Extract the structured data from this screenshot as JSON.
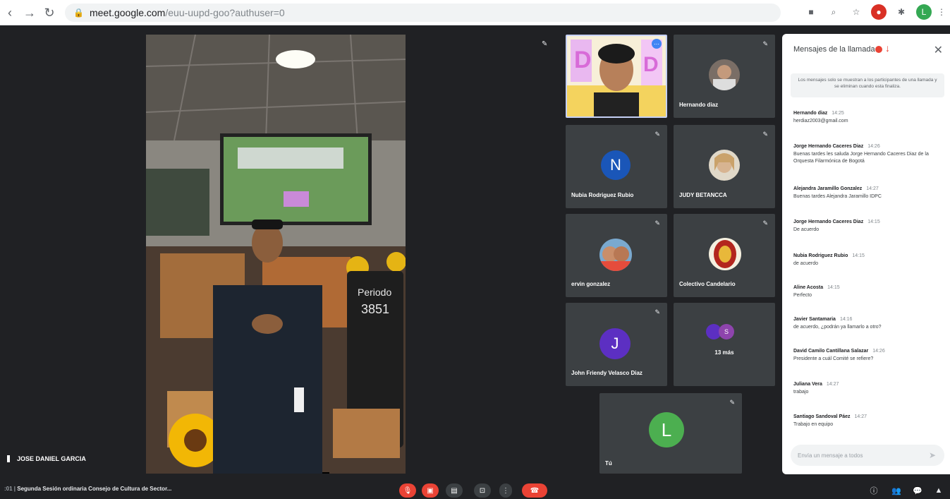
{
  "browser": {
    "url_host": "meet.google.com",
    "url_path": "/euu-uupd-goo?authuser=0"
  },
  "main_video": {
    "speaker_name": "JOSE DANIEL GARCIA",
    "chalkboard": "Periodo 3851"
  },
  "tiles": [
    {
      "name": "",
      "type": "video"
    },
    {
      "name": "Hernando diaz",
      "type": "photo"
    },
    {
      "name": "Nubia Rodriguez Rubio",
      "type": "initial",
      "initial": "N",
      "color": "#1a56b8"
    },
    {
      "name": "JUDY BETANCCA",
      "type": "photo"
    },
    {
      "name": "ervin gonzalez",
      "type": "photo"
    },
    {
      "name": "Colectivo Candelario",
      "type": "photo"
    },
    {
      "name": "John Friendy Velasco Diaz",
      "type": "initial",
      "initial": "J",
      "color": "#5c2fc2"
    },
    {
      "name": "13 más",
      "type": "more"
    },
    {
      "name": "Tú",
      "type": "initial",
      "initial": "L",
      "color": "#4caf50"
    }
  ],
  "chat": {
    "title": "Mensajes de la llamada",
    "notice": "Los mensajes solo se muestran a los participantes de una llamada y se eliminan cuando esta finaliza.",
    "messages": [
      {
        "sender": "Hernando diaz",
        "time": "14:25",
        "text": "herdiaz2003@gmail.com"
      },
      {
        "sender": "Jorge Hernando Caceres Diaz",
        "time": "14:26",
        "text": "Buenas tardes les saluda Jorge Hernando Caceres Diaz de la Orquesta Filarmónica de Bogotá"
      },
      {
        "sender": "Alejandra Jaramillo Gonzalez",
        "time": "14:27",
        "text": "Buenas tardes Alejandra Jaramillo IDPC"
      },
      {
        "sender": "Jorge Hernando Caceres Diaz",
        "time": "14:15",
        "text": "De acuerdo"
      },
      {
        "sender": "Nubia Rodriguez Rubio",
        "time": "14:15",
        "text": "de acuerdo"
      },
      {
        "sender": "Aline Acosta",
        "time": "14:15",
        "text": "Perfecto"
      },
      {
        "sender": "Javier Santamaria",
        "time": "14:16",
        "text": "de acuerdo, ¿podrán ya llamarlo a otro?"
      },
      {
        "sender": "David Camilo Cantillana Salazar",
        "time": "14:26",
        "text": "Presidente a cuál Comité se refiere?"
      },
      {
        "sender": "Juliana Vera",
        "time": "14:27",
        "text": "trabajo"
      },
      {
        "sender": "Santiago Sandoval Páez",
        "time": "14:27",
        "text": "Trabajo en equipo"
      }
    ],
    "input_placeholder": "Envía un mensaje a todos"
  },
  "bottom": {
    "meeting_title": "Segunda Sesión ordinaria Consejo de Cultura de Sector..."
  },
  "colors": {
    "meet_bg": "#202124",
    "tile_bg": "#3c4043",
    "end_call": "#ea4335"
  }
}
